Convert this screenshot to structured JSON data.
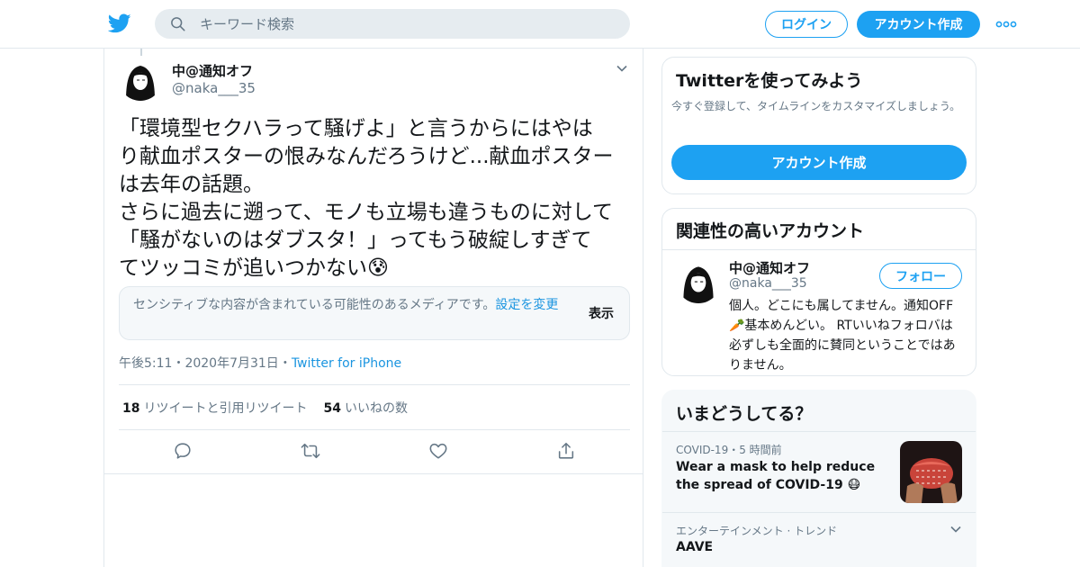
{
  "header": {
    "search_placeholder": "キーワード検索",
    "login_label": "ログイン",
    "signup_label": "アカウント作成",
    "brand_color": "#1da1f2"
  },
  "tweet": {
    "display_name": "中@通知オフ",
    "handle": "@naka___35",
    "text_lines": [
      "「環境型セクハラって騒げよ」と言うからにはやは",
      "り献血ポスターの恨みなんだろうけど...献血ポスター",
      "は去年の話題。",
      "さらに過去に遡って、モノも立場も違うものに対して",
      "「騒がないのはダブスタ！」ってもう破綻しすぎて",
      "てツッコミが追いつかない😰"
    ],
    "sensitive": {
      "message": "センシティブな内容が含まれている可能性のあるメディアです。",
      "settings_link": "設定を変更",
      "show_label": "表示"
    },
    "meta": {
      "time": "午後5:11",
      "date": "2020年7月31日",
      "separator": "・",
      "source": "Twitter for iPhone"
    },
    "stats": {
      "retweets": "18",
      "retweets_label": "リツイートと引用リツイート",
      "likes": "54",
      "likes_label": "いいねの数"
    },
    "actions": [
      "reply-icon",
      "retweet-icon",
      "like-icon",
      "share-icon"
    ]
  },
  "sidebar": {
    "signup_card": {
      "title": "Twitterを使ってみよう",
      "description": "今すぐ登録して、タイムラインをカスタマイズしましょう。",
      "button": "アカウント作成"
    },
    "related": {
      "title": "関連性の高いアカウント",
      "name": "中@通知オフ",
      "handle": "@naka___35",
      "follow": "フォロー",
      "bio": "個人。どこにも属してません。通知OFF🥕基本めんどい。 RTいいねフォロバは必ずしも全面的に賛同ということではありません。"
    },
    "trends": {
      "title": "いまどうしてる？",
      "item1_category": "COVID-19・5 時間前",
      "item1_headline": "Wear a mask to help reduce the spread of COVID-19 😷",
      "item2_category": "エンターテインメント · トレンド",
      "item2_trend": "AAVE"
    }
  }
}
